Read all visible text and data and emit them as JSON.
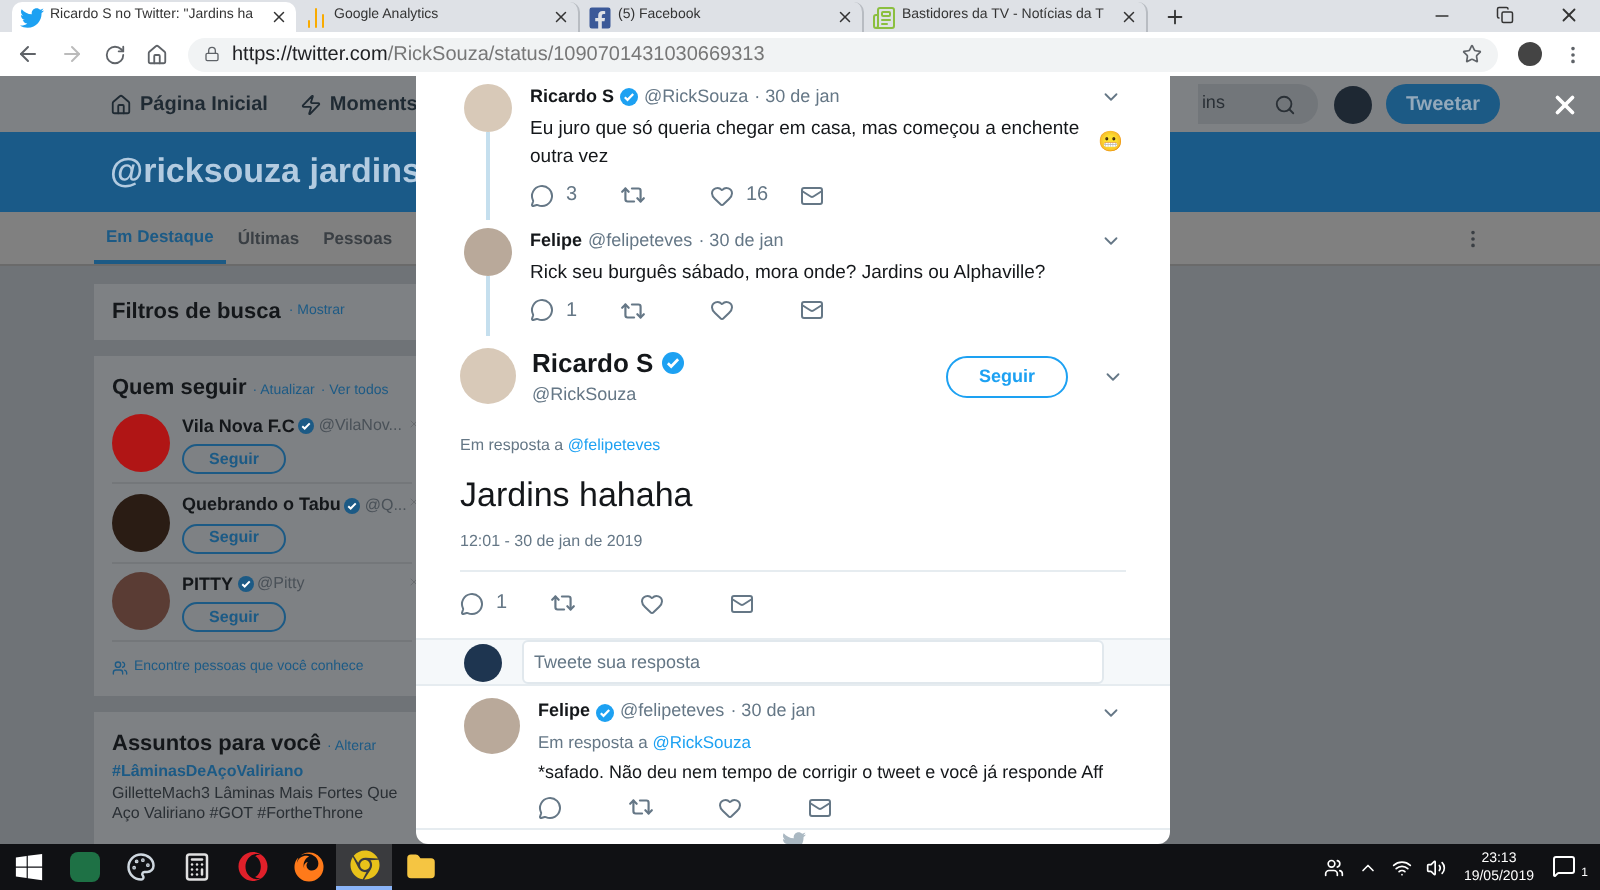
{
  "browser": {
    "tabs": [
      {
        "kind": "twitter",
        "title": "Ricardo S no Twitter: \"Jardins ha",
        "selected": true
      },
      {
        "kind": "analytics",
        "title": "Google Analytics",
        "selected": false
      },
      {
        "kind": "facebook",
        "title": "(5) Facebook",
        "selected": false
      },
      {
        "kind": "news",
        "title": "Bastidores da TV - Notícias da T",
        "selected": false
      }
    ],
    "address": {
      "host": "https://twitter.com",
      "path": "/RickSouza/status/1090701431030669313"
    }
  },
  "nav": {
    "items": [
      {
        "kind": "home",
        "label": "Página Inicial"
      },
      {
        "kind": "moments",
        "label": "Moments"
      }
    ],
    "search_value": "ins",
    "tweet_button": "Tweetar"
  },
  "banner": {
    "title": "@ricksouza jardins"
  },
  "search_tabs": [
    {
      "label": "Em Destaque",
      "selected": true
    },
    {
      "label": "Últimas",
      "selected": false
    },
    {
      "label": "Pessoas",
      "selected": false
    }
  ],
  "sidebar": {
    "filters": {
      "title": "Filtros de busca",
      "link": "· Mostrar"
    },
    "who_to_follow": {
      "title": "Quem seguir",
      "links": [
        "· Atualizar",
        "· Ver todos"
      ],
      "accounts": [
        {
          "name": "Vila Nova F.C",
          "handle": "@VilaNov...",
          "button": "Seguir",
          "color": "#b01515"
        },
        {
          "name": "Quebrando o Tabu",
          "handle": "@Q...",
          "button": "Seguir",
          "color": "#2a1c14"
        },
        {
          "name": "PITTY",
          "handle": "@Pitty",
          "button": "Seguir",
          "color": "#5a3c34"
        }
      ],
      "find_people": "Encontre pessoas que você conhece"
    },
    "trends": {
      "title": "Assuntos para você",
      "link": "· Alterar",
      "hashtag": "#LâminasDeAçoValiriano",
      "text": "GilletteMach3 Lâminas Mais Fortes Que Aço Valiriano #GOT #FortheThrone"
    }
  },
  "modal": {
    "thread": [
      {
        "name": "Ricardo S",
        "verified": true,
        "handle": "@RickSouza",
        "time": "· 30 de jan",
        "text": "Eu juro que só queria chegar em casa, mas começou a enchente outra vez",
        "emoji": "😬",
        "replies": "3",
        "likes": "16"
      },
      {
        "name": "Felipe",
        "verified": false,
        "handle": "@felipeteves",
        "time": "· 30 de jan",
        "text": "Rick seu burguês sábado, mora onde? Jardins ou Alphaville?",
        "replies": "1"
      }
    ],
    "main": {
      "name": "Ricardo S",
      "verified": true,
      "handle": "@RickSouza",
      "follow": "Seguir",
      "reply_to": "Em resposta a",
      "reply_handle": "@felipeteves",
      "text": "Jardins hahaha",
      "timestamp": "12:01 - 30 de jan de 2019",
      "replies": "1"
    },
    "reply_placeholder": "Tweete sua resposta",
    "replies": [
      {
        "name": "Felipe",
        "verified": true,
        "handle": "@felipeteves",
        "time": "· 30 de jan",
        "reply_to": "Em resposta a",
        "reply_handle": "@RickSouza",
        "text": "*safado. Não deu nem tempo de corrigir o tweet e você já responde Aff"
      }
    ]
  },
  "taskbar": {
    "apps": [
      {
        "kind": "windows",
        "active": false
      },
      {
        "kind": "excel",
        "active": false
      },
      {
        "kind": "paint",
        "active": false
      },
      {
        "kind": "calculator",
        "active": false
      },
      {
        "kind": "opera",
        "active": false
      },
      {
        "kind": "firefox",
        "active": false
      },
      {
        "kind": "chrome",
        "active": true
      },
      {
        "kind": "folder",
        "active": false
      }
    ],
    "time": "23:13",
    "date": "19/05/2019",
    "notifications": "1"
  }
}
